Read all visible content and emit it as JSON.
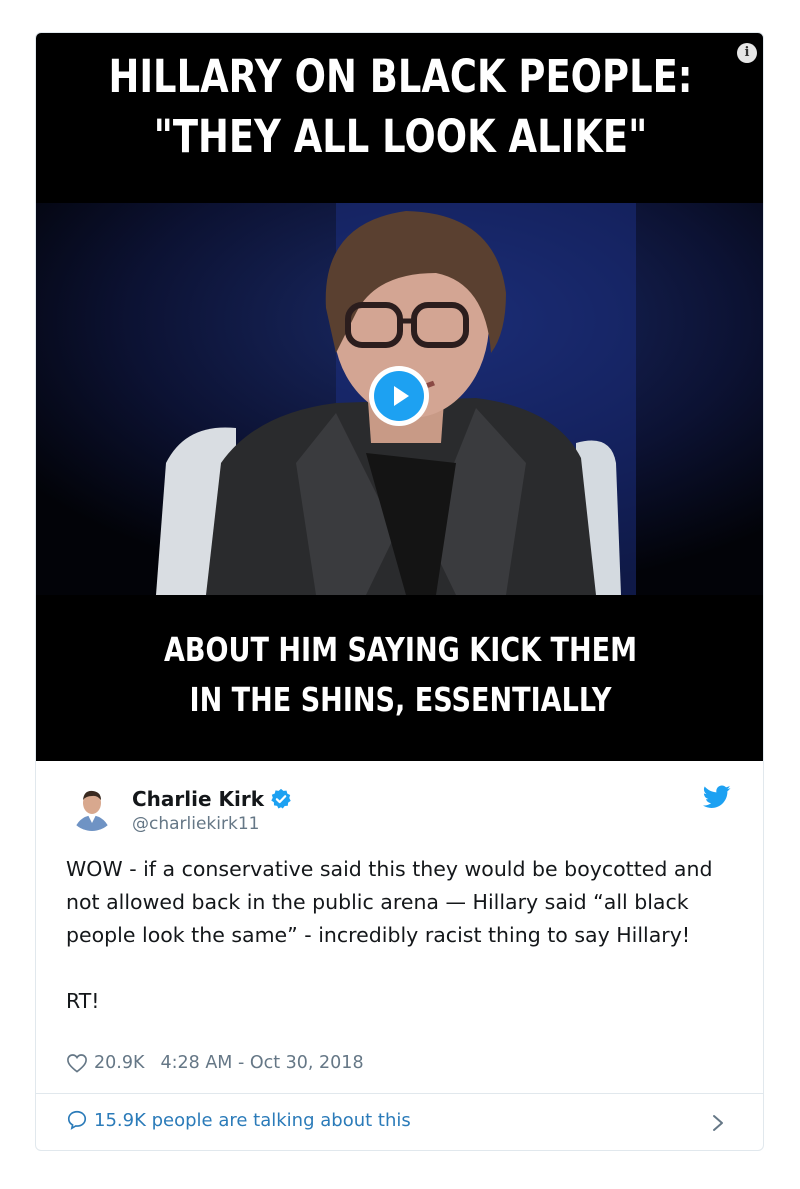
{
  "media": {
    "headline_line1": "HILLARY ON BLACK PEOPLE:",
    "headline_line2": "\"THEY ALL LOOK ALIKE\"",
    "caption_line1": "ABOUT HIM SAYING KICK THEM",
    "caption_line2": "IN THE SHINS, ESSENTIALLY",
    "info_glyph": "i"
  },
  "tweet": {
    "author_name": "Charlie Kirk",
    "author_handle": "@charliekirk11",
    "text": "WOW - if a conservative said this they would be boycotted and not allowed back in the public arena — Hillary said “all black people look the same” - incredibly racist thing to say Hillary!\n\nRT!",
    "likes": "20.9K",
    "timestamp": "4:28 AM - Oct 30, 2018",
    "talking": "15.9K people are talking about this"
  },
  "colors": {
    "brand": "#1da1f2",
    "link": "#2b7bb9",
    "muted": "#657786"
  },
  "icons": [
    "info-icon",
    "play-icon",
    "verified-icon",
    "twitter-bird-icon",
    "heart-icon",
    "speech-bubble-icon",
    "chevron-right-icon"
  ]
}
